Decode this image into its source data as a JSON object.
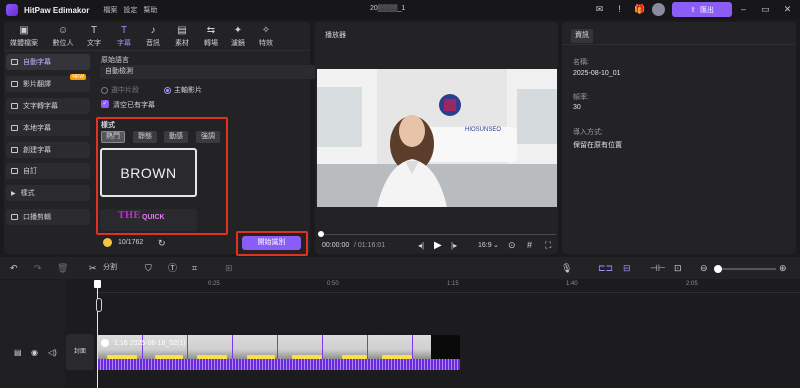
{
  "app": {
    "title": "HitPaw Edimakor",
    "menu": [
      "檔案",
      "設定",
      "幫助"
    ],
    "project_name": "20▒▒▒▒_1",
    "export_label": "匯出"
  },
  "top_categories": [
    {
      "label": "媒體檔案",
      "icon": "media-icon"
    },
    {
      "label": "數位人",
      "icon": "avatar-icon"
    },
    {
      "label": "文字",
      "icon": "text-icon"
    },
    {
      "label": "字幕",
      "icon": "subtitle-icon"
    },
    {
      "label": "音訊",
      "icon": "audio-icon"
    },
    {
      "label": "素材",
      "icon": "material-icon"
    },
    {
      "label": "轉場",
      "icon": "transition-icon"
    },
    {
      "label": "濾鏡",
      "icon": "filter-icon"
    },
    {
      "label": "特效",
      "icon": "effect-icon"
    }
  ],
  "sidebar": [
    {
      "label": "自動字幕",
      "active": true
    },
    {
      "label": "影片翻譯",
      "badge": "NEW"
    },
    {
      "label": "文字轉字幕"
    },
    {
      "label": "本地字幕"
    },
    {
      "label": "創建字幕"
    },
    {
      "label": "自訂"
    },
    {
      "label": "樣式"
    },
    {
      "label": "口播剪輯"
    }
  ],
  "subtitle": {
    "source_language_label": "原始語言",
    "source_language_value": "自動檢測",
    "option_selected_clip": "選中片段",
    "option_main_track": "主軸影片",
    "clear_existing": "清空已有字幕",
    "style_label": "樣式",
    "style_tabs": [
      "熱門",
      "靜態",
      "動感",
      "強調"
    ],
    "style_sample_1": "BROWN",
    "style_sample_2_a": "THE",
    "style_sample_2_b": "QUICK",
    "credits": "10/1762",
    "start_button": "開始識別"
  },
  "player": {
    "label": "播放器",
    "current_time": "00:00:00",
    "total_time": "/ 01:16:01",
    "aspect": "16:9",
    "logo_text": "HIOSUNSEO"
  },
  "info": {
    "tab": "資訊",
    "name_label": "名稱:",
    "name_value": "2025-08-10_01",
    "fps_label": "幀率:",
    "fps_value": "30",
    "import_label": "導入方式:",
    "import_value": "保留在原有位置"
  },
  "timeline": {
    "split_label": "分割",
    "ruler": [
      "0:25",
      "0:50",
      "1:15",
      "1:40",
      "2:05"
    ],
    "clip_label": "1:16 2025-06-18_02(1)",
    "cover_label": "封面"
  },
  "colors": {
    "accent": "#8b5cf6",
    "highlight_red": "#e0321f",
    "panel_bg": "#232326",
    "app_bg": "#1b1b1d"
  }
}
